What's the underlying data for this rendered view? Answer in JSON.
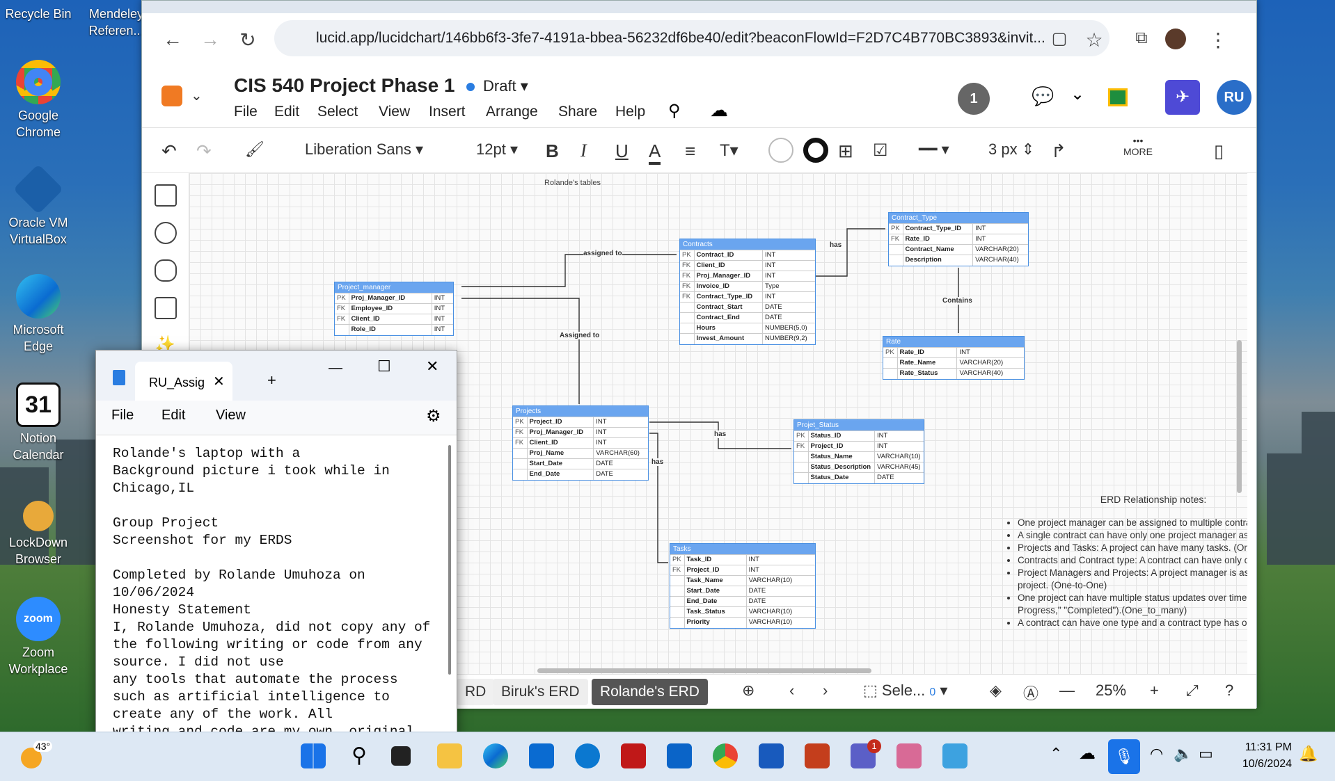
{
  "desktop_icons": [
    {
      "label": "Recycle Bin"
    },
    {
      "label": "Mendeley Referen..."
    },
    {
      "label": "Google Chrome"
    },
    {
      "label": "Oracle VM VirtualBox"
    },
    {
      "label": "Microsoft Edge"
    },
    {
      "label": "Notion Calendar"
    },
    {
      "label": "LockDown Browser"
    },
    {
      "label": "Zoom Workplace"
    }
  ],
  "browser": {
    "url": "lucid.app/lucidchart/146bb6f3-3fe7-4191a-bbea-56232df6be40/edit?beaconFlowId=F2D7C4B770BC3893&invit..."
  },
  "lucid": {
    "title": "CIS 540 Project Phase 1",
    "status": "Draft",
    "menu": [
      "File",
      "Edit",
      "Select",
      "View",
      "Insert",
      "Arrange",
      "Share",
      "Help"
    ],
    "collab_count": "1",
    "avatar": "RU",
    "font": "Liberation Sans",
    "font_size": "12pt",
    "line_width": "3 px",
    "more": "MORE",
    "zoom": "25%",
    "select_label": "Sele...",
    "select_count": "0",
    "pages": [
      "RD",
      "Biruk's ERD",
      "Rolande's ERD"
    ]
  },
  "diagram": {
    "page_title": "Rolande's tables",
    "tables": [
      {
        "id": "project_manager",
        "name": "Project_manager",
        "rows": [
          [
            "PK",
            "Proj_Manager_ID",
            "INT"
          ],
          [
            "FK",
            "Employee_ID",
            "INT"
          ],
          [
            "FK",
            "Client_ID",
            "INT"
          ],
          [
            "",
            "Role_ID",
            "INT"
          ]
        ]
      },
      {
        "id": "contracts",
        "name": "Contracts",
        "rows": [
          [
            "PK",
            "Contract_ID",
            "INT"
          ],
          [
            "FK",
            "Client_ID",
            "INT"
          ],
          [
            "FK",
            "Proj_Manager_ID",
            "INT"
          ],
          [
            "FK",
            "Invoice_ID",
            "Type"
          ],
          [
            "FK",
            "Contract_Type_ID",
            "INT"
          ],
          [
            "",
            "Contract_Start",
            "DATE"
          ],
          [
            "",
            "Contract_End",
            "DATE"
          ],
          [
            "",
            "Hours",
            "NUMBER(5,0)"
          ],
          [
            "",
            "Invest_Amount",
            "NUMBER(9,2)"
          ]
        ]
      },
      {
        "id": "contract_type",
        "name": "Contract_Type",
        "rows": [
          [
            "PK",
            "Contract_Type_ID",
            "INT"
          ],
          [
            "FK",
            "Rate_ID",
            "INT"
          ],
          [
            "",
            "Contract_Name",
            "VARCHAR(20)"
          ],
          [
            "",
            "Description",
            "VARCHAR(40)"
          ]
        ]
      },
      {
        "id": "rate",
        "name": "Rate",
        "rows": [
          [
            "PK",
            "Rate_ID",
            "INT"
          ],
          [
            "",
            "Rate_Name",
            "VARCHAR(20)"
          ],
          [
            "",
            "Rate_Status",
            "VARCHAR(40)"
          ]
        ]
      },
      {
        "id": "projects",
        "name": "Projects",
        "rows": [
          [
            "PK",
            "Project_ID",
            "INT"
          ],
          [
            "FK",
            "Proj_Manager_ID",
            "INT"
          ],
          [
            "FK",
            "Client_ID",
            "INT"
          ],
          [
            "",
            "Proj_Name",
            "VARCHAR(60)"
          ],
          [
            "",
            "Start_Date",
            "DATE"
          ],
          [
            "",
            "End_Date",
            "DATE"
          ]
        ]
      },
      {
        "id": "projet_status",
        "name": "Projet_Status",
        "rows": [
          [
            "PK",
            "Status_ID",
            "INT"
          ],
          [
            "FK",
            "Project_ID",
            "INT"
          ],
          [
            "",
            "Status_Name",
            "VARCHAR(10)"
          ],
          [
            "",
            "Status_Description",
            "VARCHAR(45)"
          ],
          [
            "",
            "Status_Date",
            "DATE"
          ]
        ]
      },
      {
        "id": "tasks",
        "name": "Tasks",
        "rows": [
          [
            "PK",
            "Task_ID",
            "INT"
          ],
          [
            "FK",
            "Project_ID",
            "INT"
          ],
          [
            "",
            "Task_Name",
            "VARCHAR(10)"
          ],
          [
            "",
            "Start_Date",
            "DATE"
          ],
          [
            "",
            "End_Date",
            "DATE"
          ],
          [
            "",
            "Task_Status",
            "VARCHAR(10)"
          ],
          [
            "",
            "Priority",
            "VARCHAR(10)"
          ]
        ]
      }
    ],
    "relation_labels": [
      "assigned to",
      "has",
      "Contains",
      "Assigned to",
      "has",
      "has"
    ],
    "notes_title": "ERD Relationship notes:",
    "notes": [
      "One project manager can be assigned to multiple contracts.(one-to-many)",
      "A single contract can have only one project manager assigned to it.",
      "Projects and Tasks: A project can have many tasks. (One-to-Many)",
      "Contracts and Contract type: A contract can have  only onet type (One-to-one)",
      "Project Managers and Projects: A project manager is assigned to a specific project. (One-to-One)",
      "One project can have multiple status updates over time (\"Not Started,\" \"In Progress,\" \"Completed\").(One_to_many)",
      "A contract can have one type and a contract type has only its corresponding rate."
    ]
  },
  "notepad": {
    "tab": "RU_Assig",
    "menu": [
      "File",
      "Edit",
      "View"
    ],
    "text": "Rolande's laptop with a\nBackground picture i took while in\nChicago,IL\n\nGroup Project\nScreenshot for my ERDS\n\nCompleted by Rolande Umuhoza on\n10/06/2024\nHonesty Statement\nI, Rolande Umuhoza, did not copy any of\nthe following writing or code from any\nsource. I did not use\nany tools that automate the process\nsuch as artificial intelligence to\ncreate any of the work. All\nwriting and code are my own, original"
  },
  "taskbar": {
    "weather": "43°",
    "time": "11:31 PM",
    "date": "10/6/2024",
    "teams_badge": "1"
  }
}
